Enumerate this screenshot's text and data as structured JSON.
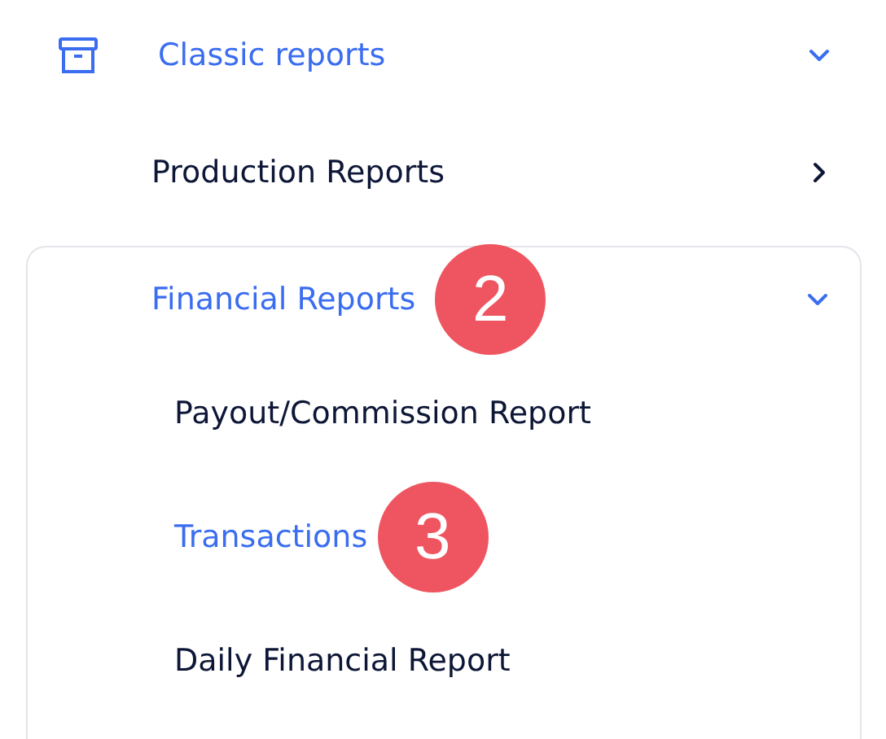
{
  "section": {
    "label": "Classic reports",
    "selected": true,
    "expanded": true
  },
  "items": [
    {
      "label": "Production Reports",
      "selected": false,
      "expanded": false
    },
    {
      "label": "Financial Reports",
      "selected": true,
      "expanded": true,
      "badge": "2",
      "children": [
        {
          "label": "Payout/Commission Report",
          "selected": false
        },
        {
          "label": "Transactions",
          "selected": true,
          "badge": "3"
        },
        {
          "label": "Daily Financial Report",
          "selected": false
        }
      ]
    }
  ]
}
